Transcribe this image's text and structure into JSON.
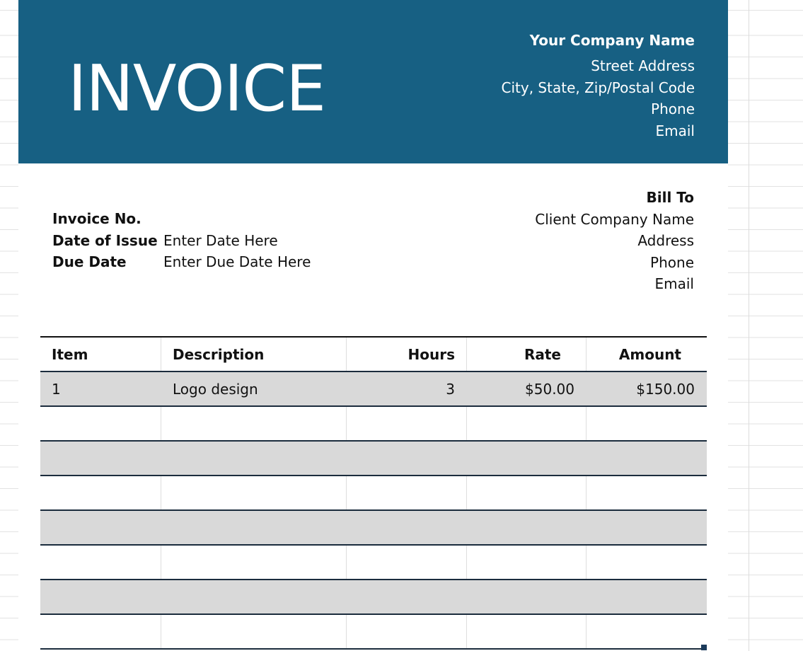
{
  "header": {
    "title": "INVOICE",
    "company_name": "Your Company Name",
    "street": "Street Address",
    "city": "City, State, Zip/Postal Code",
    "phone": "Phone",
    "email": "Email"
  },
  "invoice_info": {
    "number_label": "Invoice No.",
    "number_value": "",
    "issue_label": "Date of Issue",
    "issue_value": "Enter Date Here",
    "due_label": "Due Date",
    "due_value": "Enter Due Date Here"
  },
  "bill_to": {
    "title": "Bill To",
    "company": "Client Company Name",
    "address": "Address",
    "phone": "Phone",
    "email": "Email"
  },
  "table": {
    "columns": [
      "Item",
      "Description",
      "Hours",
      "Rate",
      "Amount"
    ],
    "rows": [
      [
        "1",
        "Logo design",
        "3",
        "$50.00",
        "$150.00"
      ],
      [
        "",
        "",
        "",
        "",
        ""
      ],
      [
        "",
        "",
        "",
        "",
        ""
      ],
      [
        "",
        "",
        "",
        "",
        ""
      ],
      [
        "",
        "",
        "",
        "",
        ""
      ],
      [
        "",
        "",
        "",
        "",
        ""
      ],
      [
        "",
        "",
        "",
        "",
        ""
      ],
      [
        "",
        "",
        "",
        "",
        ""
      ]
    ]
  },
  "colors": {
    "header_bg": "#176083",
    "row_shade": "#d9d9d9"
  }
}
